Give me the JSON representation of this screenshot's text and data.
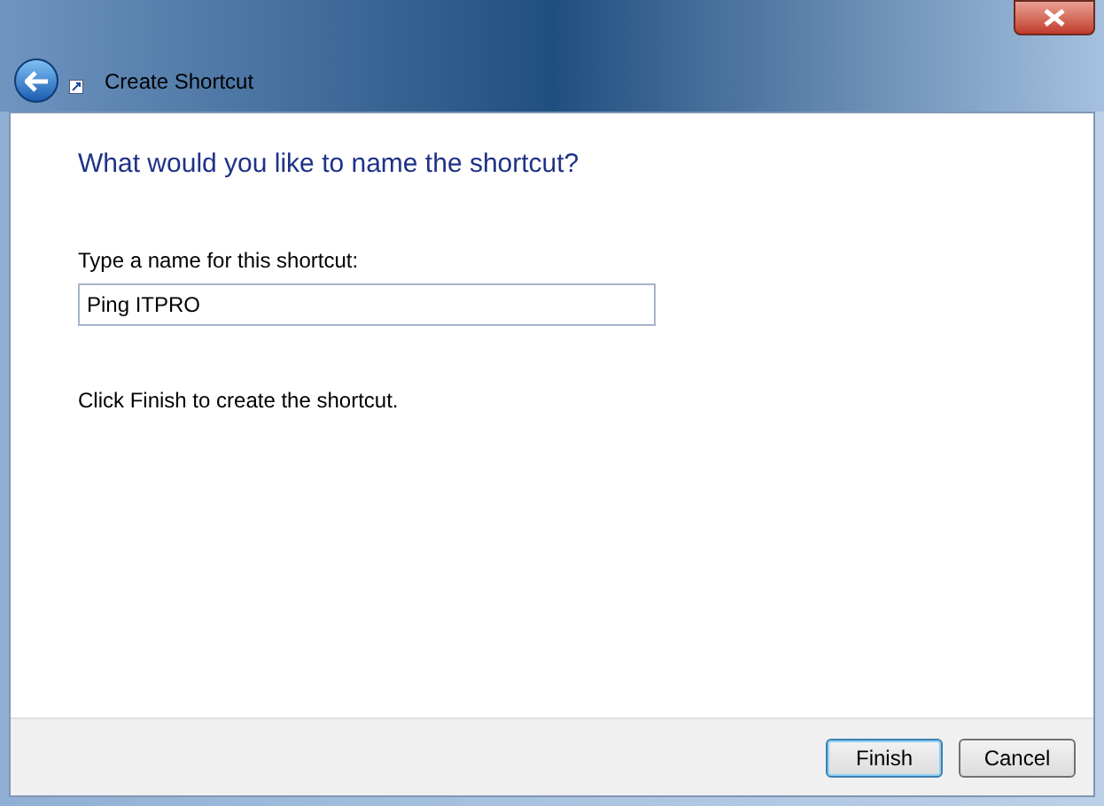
{
  "window": {
    "title": "Create Shortcut"
  },
  "heading": "What would you like to name the shortcut?",
  "name_field": {
    "label": "Type a name for this shortcut:",
    "value": "Ping ITPRO"
  },
  "instruction": "Click Finish to create the shortcut.",
  "buttons": [
    {
      "label": "Finish",
      "kind": "default"
    },
    {
      "label": "Cancel",
      "kind": "normal"
    }
  ]
}
